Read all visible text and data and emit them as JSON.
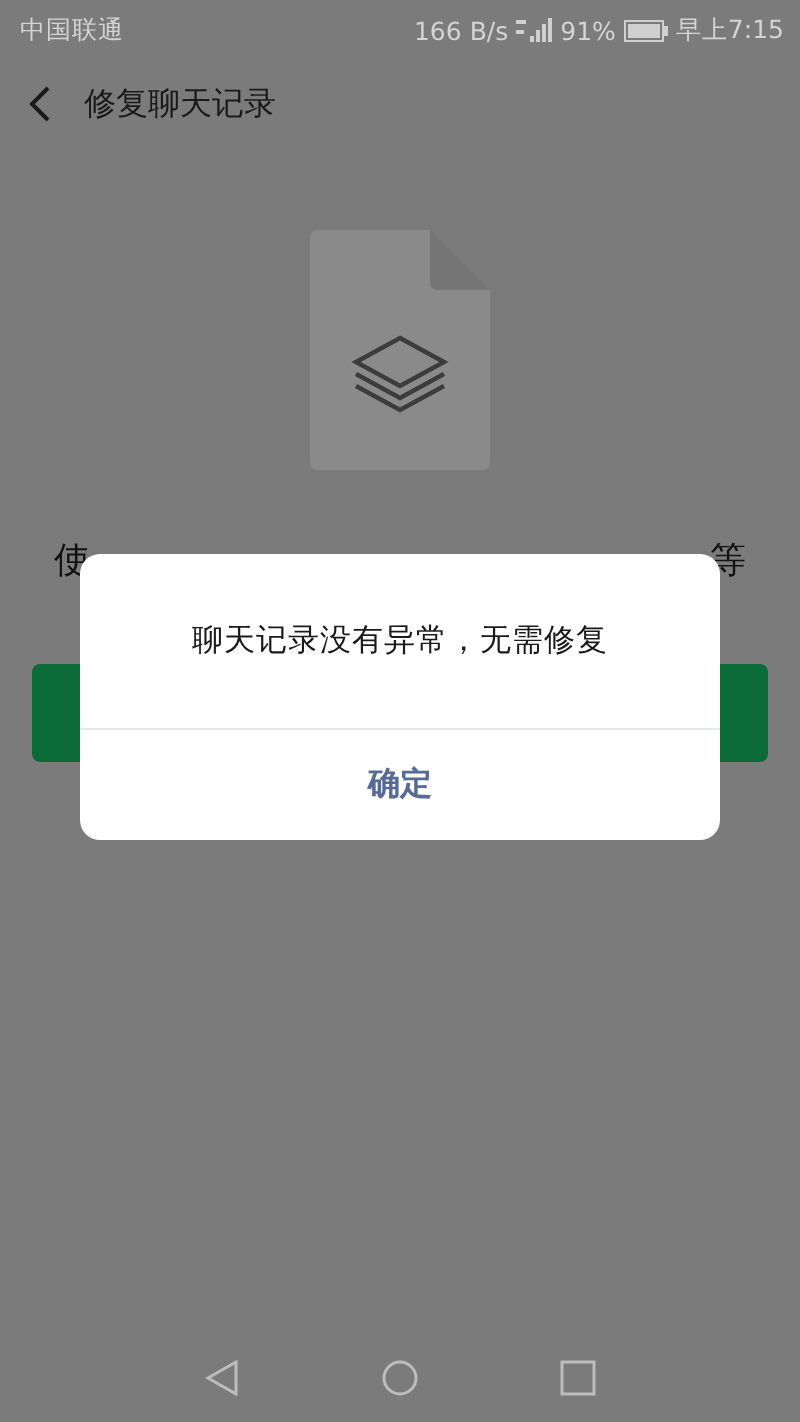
{
  "status_bar": {
    "carrier": "中国联通",
    "speed": "166 B/s",
    "battery_percent": "91%",
    "time": "早上7:15"
  },
  "header": {
    "title": "修复聊天记录"
  },
  "description": {
    "start": "使",
    "end": "等"
  },
  "dialog": {
    "message": "聊天记录没有异常，无需修复",
    "button": "确定"
  }
}
